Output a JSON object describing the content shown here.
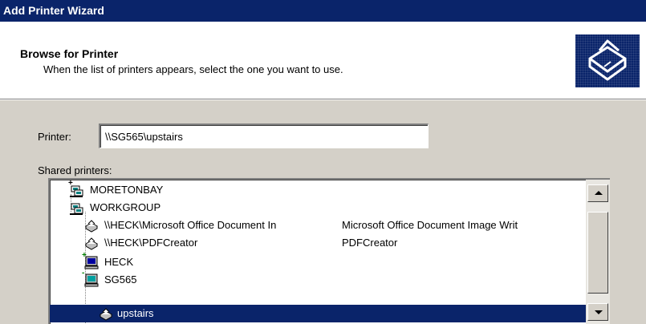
{
  "window": {
    "title": "Add Printer Wizard"
  },
  "header": {
    "title": "Browse for Printer",
    "subtitle": "When the list of printers appears, select the one you want to use.",
    "icon": "printer-wizard-icon"
  },
  "printer_field": {
    "label": "Printer:",
    "value": "\\\\SG565\\upstairs"
  },
  "shared_printers": {
    "label": "Shared printers:",
    "items": [
      {
        "name": "MORETONBAY",
        "comment": "",
        "icon": "network-domain-icon",
        "expander": "+"
      },
      {
        "name": "WORKGROUP",
        "comment": "",
        "icon": "network-domain-icon",
        "expander": ""
      },
      {
        "name": "\\\\HECK\\Microsoft Office Document In",
        "comment": "Microsoft Office Document Image Writ",
        "icon": "printer-icon",
        "expander": ""
      },
      {
        "name": "\\\\HECK\\PDFCreator",
        "comment": "PDFCreator",
        "icon": "printer-icon",
        "expander": ""
      },
      {
        "name": "HECK",
        "comment": "",
        "icon": "computer-icon",
        "expander": "+"
      },
      {
        "name": "SG565",
        "comment": "",
        "icon": "computer-icon",
        "expander": "-"
      },
      {
        "name": "upstairs",
        "comment": "",
        "icon": "printer-icon",
        "expander": "",
        "selected": true
      }
    ]
  },
  "colors": {
    "title_bar": "#0a246a",
    "selection": "#0a246a",
    "dialog_face": "#d4d0c8"
  }
}
